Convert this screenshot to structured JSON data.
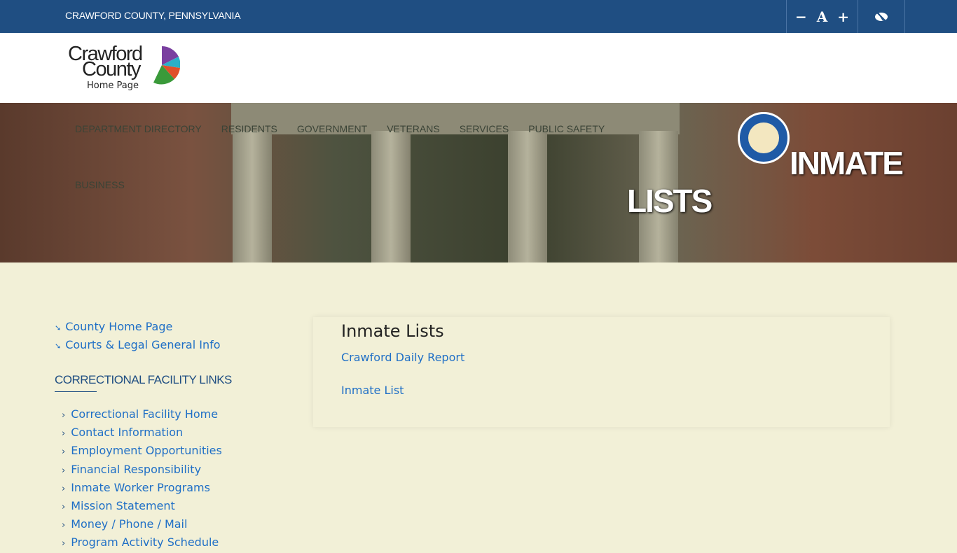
{
  "topbar": {
    "county": "CRAWFORD COUNTY, PENNSYLVANIA",
    "tools": {
      "decrease": "−",
      "font": "A",
      "increase": "+"
    }
  },
  "logo": {
    "line1": "Crawford",
    "line2": "County",
    "line3": "Home Page"
  },
  "nav": [
    "DEPARTMENT DIRECTORY",
    "RESIDENTS",
    "GOVERNMENT",
    "VETERANS",
    "SERVICES",
    "PUBLIC SAFETY",
    "BUSINESS"
  ],
  "hero": {
    "title_line1": "INMATE",
    "title_line2": "LISTS"
  },
  "sidebar": {
    "top_links": [
      "County Home Page",
      "Courts & Legal General Info"
    ],
    "heading": "CORRECTIONAL FACILITY LINKS",
    "links": [
      "Correctional Facility Home",
      "Contact Information",
      "Employment Opportunities",
      "Financial Responsibility",
      "Inmate Worker Programs",
      "Mission Statement",
      "Money / Phone / Mail",
      "Program Activity Schedule"
    ]
  },
  "main": {
    "title": "Inmate Lists",
    "links": [
      "Crawford Daily Report",
      "Inmate List"
    ]
  },
  "colors": {
    "topbar": "#1f4e82",
    "link": "#1f6fc6",
    "background": "#f2f0d7"
  }
}
